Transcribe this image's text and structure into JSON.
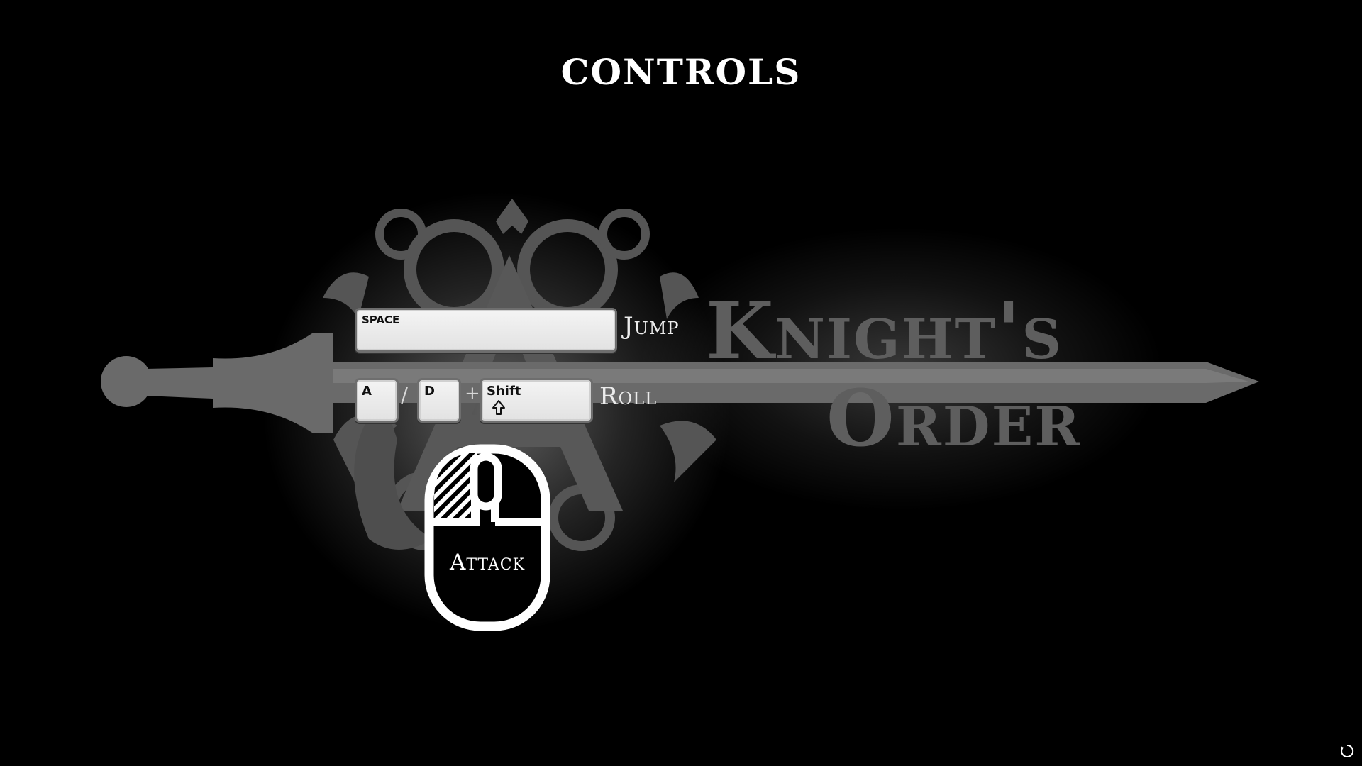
{
  "screen": {
    "title": "CONTROLS"
  },
  "background": {
    "logo_line1": "Knight's",
    "logo_line2": "Order",
    "logo_monogram": "A"
  },
  "controls": {
    "jump": {
      "key": "SPACE",
      "action": "Jump"
    },
    "roll": {
      "key_left": "A",
      "separator": "/",
      "key_right": "D",
      "plus": "+",
      "key_modifier": "Shift",
      "modifier_icon": "shift-arrow-icon",
      "action": "Roll"
    },
    "attack": {
      "input": "mouse-left-button",
      "action": "Attack"
    }
  },
  "colors": {
    "background": "#000000",
    "emblem": "#5a5a5a",
    "text": "#ffffff",
    "key_face": "#eeeeee"
  },
  "status": {
    "loading_icon": "loading-spinner-icon"
  }
}
